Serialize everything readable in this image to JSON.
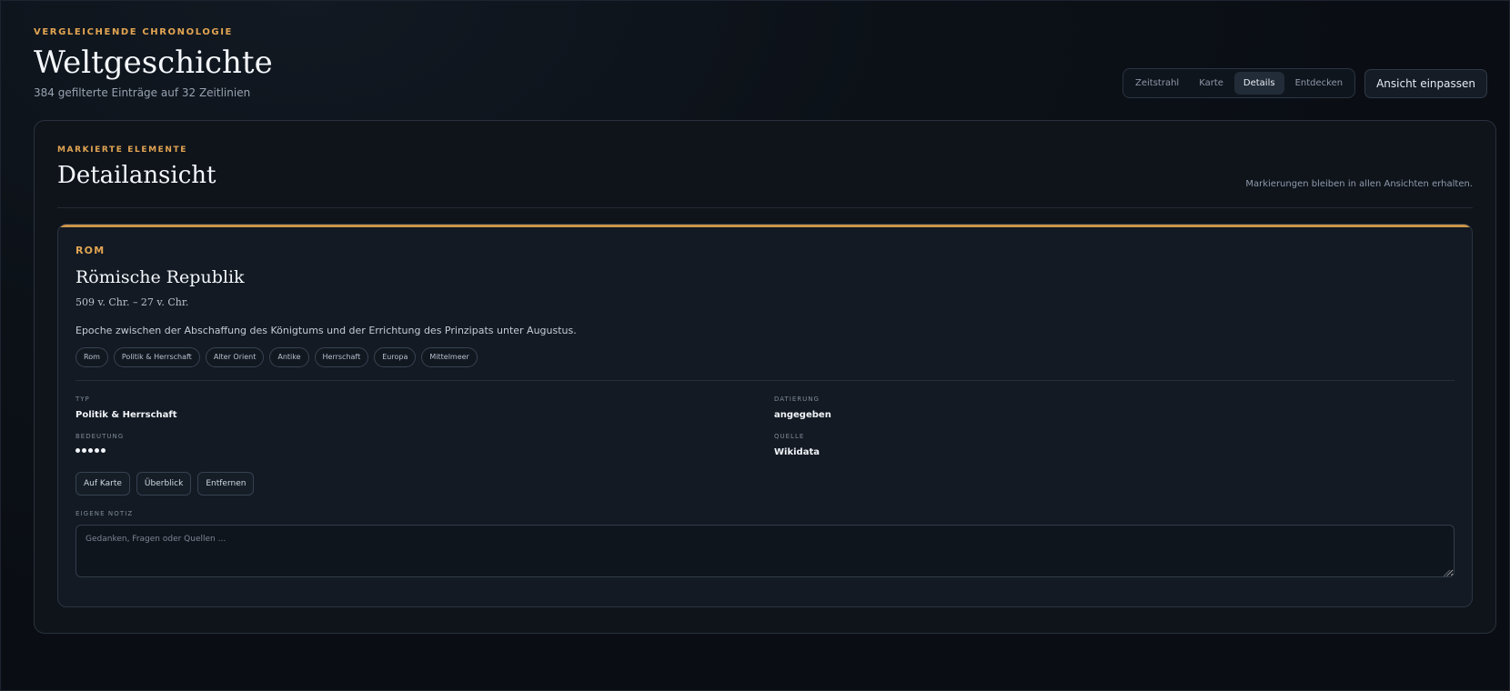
{
  "header": {
    "eyebrow": "VERGLEICHENDE CHRONOLOGIE",
    "title": "Weltgeschichte",
    "subtitle": "384 gefilterte Einträge auf 32 Zeitlinien"
  },
  "view_tabs": {
    "items": [
      {
        "label": "Zeitstrahl",
        "active": false
      },
      {
        "label": "Karte",
        "active": false
      },
      {
        "label": "Details",
        "active": true
      },
      {
        "label": "Entdecken",
        "active": false
      }
    ],
    "fit_button_label": "Ansicht einpassen"
  },
  "panel": {
    "eyebrow": "MARKIERTE ELEMENTE",
    "title": "Detailansicht",
    "note": "Markierungen bleiben in allen Ansichten erhalten."
  },
  "entry": {
    "category": "ROM",
    "title": "Römische Republik",
    "dates": "509 v. Chr. – 27 v. Chr.",
    "description": "Epoche zwischen der Abschaffung des Königtums und der Errichtung des Prinzipats unter Augustus.",
    "tags": [
      "Rom",
      "Politik & Herrschaft",
      "Alter Orient",
      "Antike",
      "Herrschaft",
      "Europa",
      "Mittelmeer"
    ],
    "meta": {
      "typ_label": "TYP",
      "typ_value": "Politik & Herrschaft",
      "datierung_label": "DATIERUNG",
      "datierung_value": "angegeben",
      "bedeutung_label": "BEDEUTUNG",
      "bedeutung_rating": 5,
      "quelle_label": "QUELLE",
      "quelle_value": "Wikidata"
    },
    "actions": {
      "on_map": "Auf Karte",
      "overview": "Überblick",
      "remove": "Entfernen"
    },
    "note": {
      "label": "EIGENE NOTIZ",
      "placeholder": "Gedanken, Fragen oder Quellen ...",
      "value": ""
    }
  },
  "colors": {
    "accent": "#E2A552",
    "background": "#0C1118",
    "panel": "#0F141B",
    "card": "#131A23"
  },
  "icons": {
    "resize_handle": "resize-handle-icon",
    "rating_dot": "dot-icon"
  }
}
